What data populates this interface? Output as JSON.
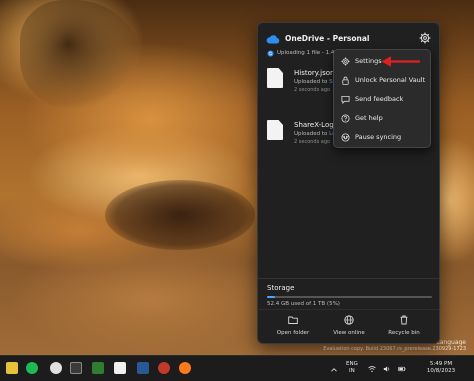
{
  "onedrive": {
    "title": "OneDrive - Personal",
    "status": "Uploading 1 file - 1.4 MB of 1.5 MB",
    "files": [
      {
        "name": "History.json",
        "sub_prefix": "Uploaded to ",
        "sub_link": "St",
        "time": "2 seconds ago"
      },
      {
        "name": "ShareX-Log-2023-10",
        "sub_prefix": "Uploaded to ",
        "sub_link": "Lo",
        "time": "2 seconds ago"
      }
    ],
    "storage": {
      "title": "Storage",
      "text": "52.4 GB used of 1 TB (5%)",
      "fraction": 0.05
    },
    "actions": [
      {
        "label": "Open folder",
        "icon": "folder-icon"
      },
      {
        "label": "View online",
        "icon": "globe-icon"
      },
      {
        "label": "Recycle bin",
        "icon": "trash-icon"
      }
    ]
  },
  "menu": {
    "items": [
      {
        "label": "Settings",
        "icon": "gear-icon"
      },
      {
        "label": "Unlock Personal Vault",
        "icon": "lock-icon"
      },
      {
        "label": "Send feedback",
        "icon": "feedback-icon"
      },
      {
        "label": "Get help",
        "icon": "help-icon"
      },
      {
        "label": "Pause syncing",
        "icon": "pause-icon"
      }
    ]
  },
  "watermark": {
    "line1": "e Language",
    "line2": "Evaluation copy. Build 23067.rs_prerelease.230929-1723"
  },
  "taskbar": {
    "lang_line1": "ENG",
    "lang_line2": "IN",
    "time": "5:49 PM",
    "date": "10/8/2023"
  },
  "colors": {
    "accent": "#4fa3ff",
    "arrow": "#e02020",
    "flyout_bg": "#202020"
  }
}
